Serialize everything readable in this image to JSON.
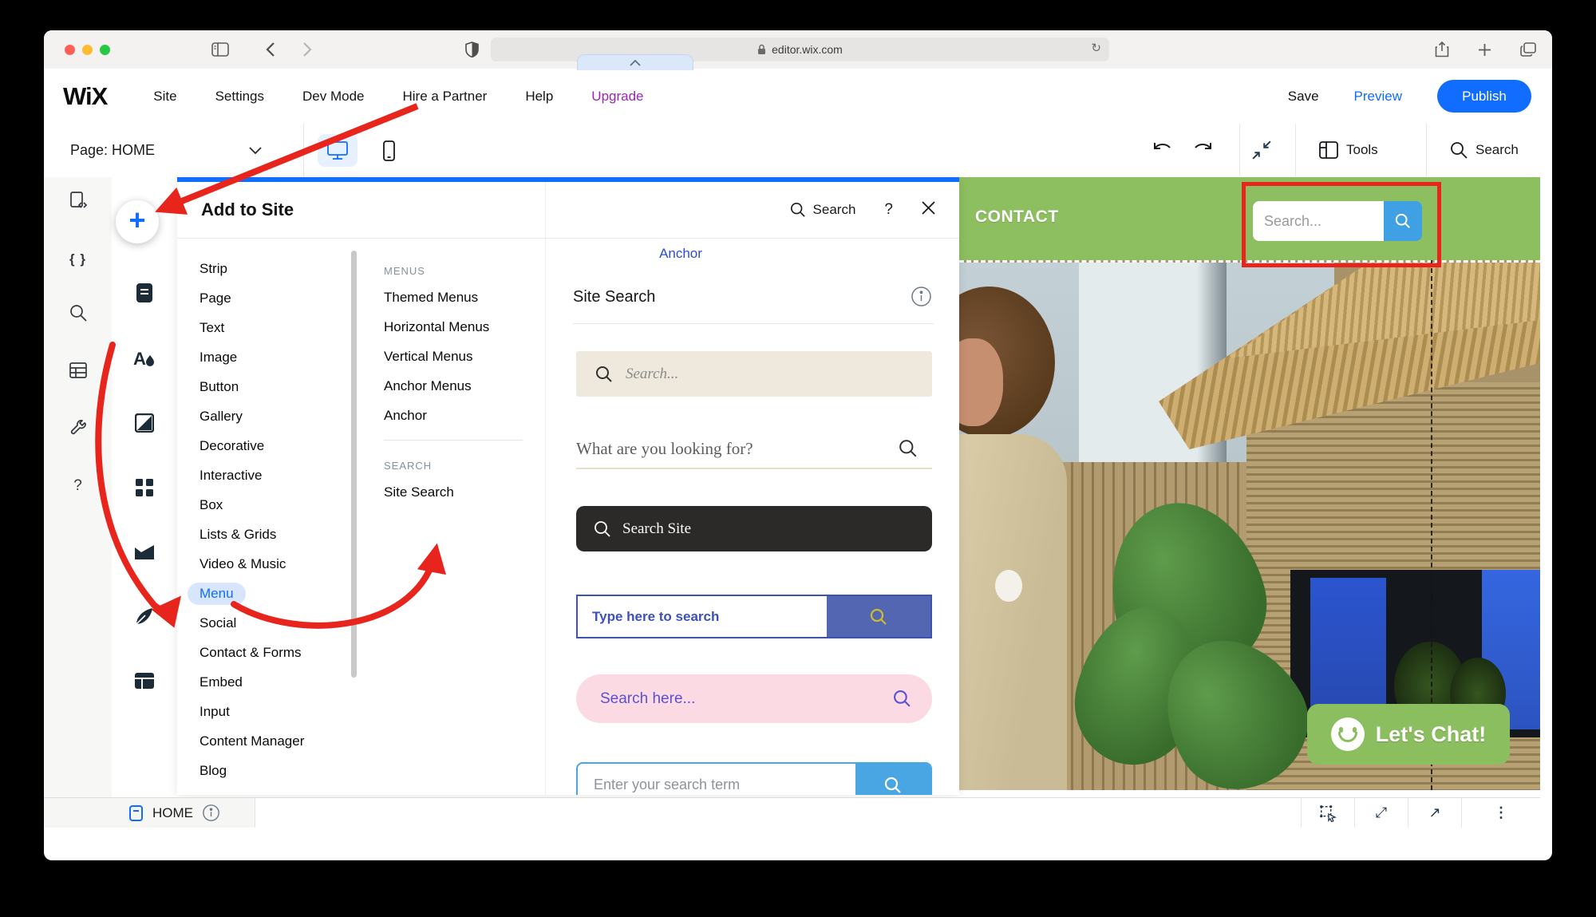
{
  "browser": {
    "url": "editor.wix.com"
  },
  "top_nav": {
    "logo": "WiX",
    "menu": [
      "Site",
      "Settings",
      "Dev Mode",
      "Hire a Partner",
      "Help"
    ],
    "upgrade": "Upgrade",
    "save": "Save",
    "preview": "Preview",
    "publish": "Publish"
  },
  "toolbar": {
    "page_selector": "Page: HOME",
    "tools": "Tools",
    "search": "Search"
  },
  "add_panel": {
    "title": "Add to Site",
    "search": "Search",
    "help": "?",
    "categories": [
      "Strip",
      "Page",
      "Text",
      "Image",
      "Button",
      "Gallery",
      "Decorative",
      "Interactive",
      "Box",
      "Lists & Grids",
      "Video & Music",
      "Menu",
      "Social",
      "Contact & Forms",
      "Embed",
      "Input",
      "Content Manager",
      "Blog"
    ],
    "active_category": "Menu",
    "sections": [
      {
        "header": "MENUS",
        "items": [
          "Themed Menus",
          "Horizontal Menus",
          "Vertical Menus",
          "Anchor Menus",
          "Anchor"
        ]
      },
      {
        "header": "SEARCH",
        "items": [
          "Site Search"
        ]
      }
    ],
    "content": {
      "breadcrumb": "Anchor",
      "title": "Site Search",
      "previews": [
        {
          "placeholder": "Search...",
          "style": "beige-bar"
        },
        {
          "placeholder": "What are you looking for?",
          "style": "serif-underline"
        },
        {
          "placeholder": "Search Site",
          "style": "dark-bar"
        },
        {
          "placeholder": "Type here to search",
          "style": "indigo-button-bar"
        },
        {
          "placeholder": "Search here...",
          "style": "pink-pill"
        },
        {
          "placeholder": "Enter your search term",
          "style": "blue-button-bar"
        }
      ]
    }
  },
  "site_preview": {
    "header_label": "CONTACT",
    "search_placeholder": "Search...",
    "chat_button": "Let's Chat!"
  },
  "bottom_bar": {
    "page_name": "HOME"
  },
  "glyphs": {
    "reload": "↻",
    "question": "?",
    "braces": "{ }",
    "kebab": "⋮",
    "resize": "⤢",
    "open": "↗",
    "plus": "+",
    "chevron_up": "⌃"
  },
  "colors": {
    "accent_blue": "#116dff",
    "upgrade_purple": "#9a27b0",
    "annotation_red": "#e8251d",
    "site_green": "#8dbe5f"
  }
}
